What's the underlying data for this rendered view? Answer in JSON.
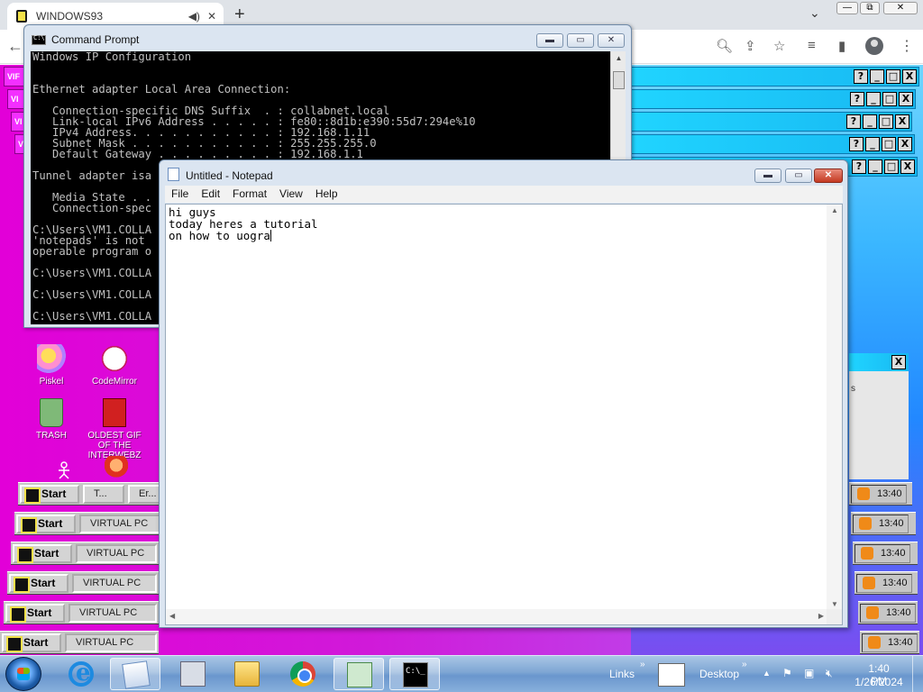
{
  "browser": {
    "tab_title": "WINDOWS93",
    "window_controls": {
      "minimize": "—",
      "maximize": "⧉",
      "close": "✕"
    },
    "toolbar_icons": [
      "back-icon",
      "search-icon",
      "share-icon",
      "star-icon",
      "media-icon",
      "sidebar-icon",
      "profile-icon",
      "menu-icon"
    ]
  },
  "win93": {
    "window_buttons": {
      "help": "?",
      "minimize": "_",
      "maximize": "□",
      "close": "X"
    },
    "left_caps": [
      "VIF",
      "VI",
      "VI",
      "V",
      ""
    ],
    "desktop_icons": [
      {
        "label": "Piskel"
      },
      {
        "label": "CodeMirror"
      },
      {
        "label": "TRASH"
      },
      {
        "label": "OLDEST GIF OF THE INTERWEBZ"
      }
    ],
    "taskbars": [
      {
        "start": "Start",
        "tasks": [
          "T...",
          "Er..."
        ],
        "time": "13:40"
      },
      {
        "start": "Start",
        "tasks": [
          "VIRTUAL PC"
        ],
        "time": "13:40"
      },
      {
        "start": "Start",
        "tasks": [
          "VIRTUAL PC"
        ],
        "time": "13:40"
      },
      {
        "start": "Start",
        "tasks": [
          "VIRTUAL PC"
        ],
        "time": "13:40"
      },
      {
        "start": "Start",
        "tasks": [
          "VIRTUAL PC"
        ],
        "time": "13:40"
      },
      {
        "start": "Start",
        "tasks": [
          "VIRTUAL PC"
        ],
        "time": "13:40"
      }
    ],
    "gray_panel_text": "s"
  },
  "cmd": {
    "title": "Command Prompt",
    "lines": [
      "Windows IP Configuration",
      "",
      "",
      "Ethernet adapter Local Area Connection:",
      "",
      "   Connection-specific DNS Suffix  . : collabnet.local",
      "   Link-local IPv6 Address . . . . . : fe80::8d1b:e390:55d7:294e%10",
      "   IPv4 Address. . . . . . . . . . . : 192.168.1.11",
      "   Subnet Mask . . . . . . . . . . . : 255.255.255.0",
      "   Default Gateway . . . . . . . . . : 192.168.1.1",
      "",
      "Tunnel adapter isa",
      "",
      "   Media State . .",
      "   Connection-spec",
      "",
      "C:\\Users\\VM1.COLLA",
      "'notepads' is not",
      "operable program o",
      "",
      "C:\\Users\\VM1.COLLA",
      "",
      "C:\\Users\\VM1.COLLA",
      "",
      "C:\\Users\\VM1.COLLA"
    ]
  },
  "notepad": {
    "title": "Untitled - Notepad",
    "menu": [
      "File",
      "Edit",
      "Format",
      "View",
      "Help"
    ],
    "text": "hi guys\ntoday heres a tutorial\non how to uogra"
  },
  "taskbar": {
    "links_label": "Links",
    "desktop_label": "Desktop",
    "time": "1:40 PM",
    "date": "1/26/2024",
    "chevron": "»"
  }
}
